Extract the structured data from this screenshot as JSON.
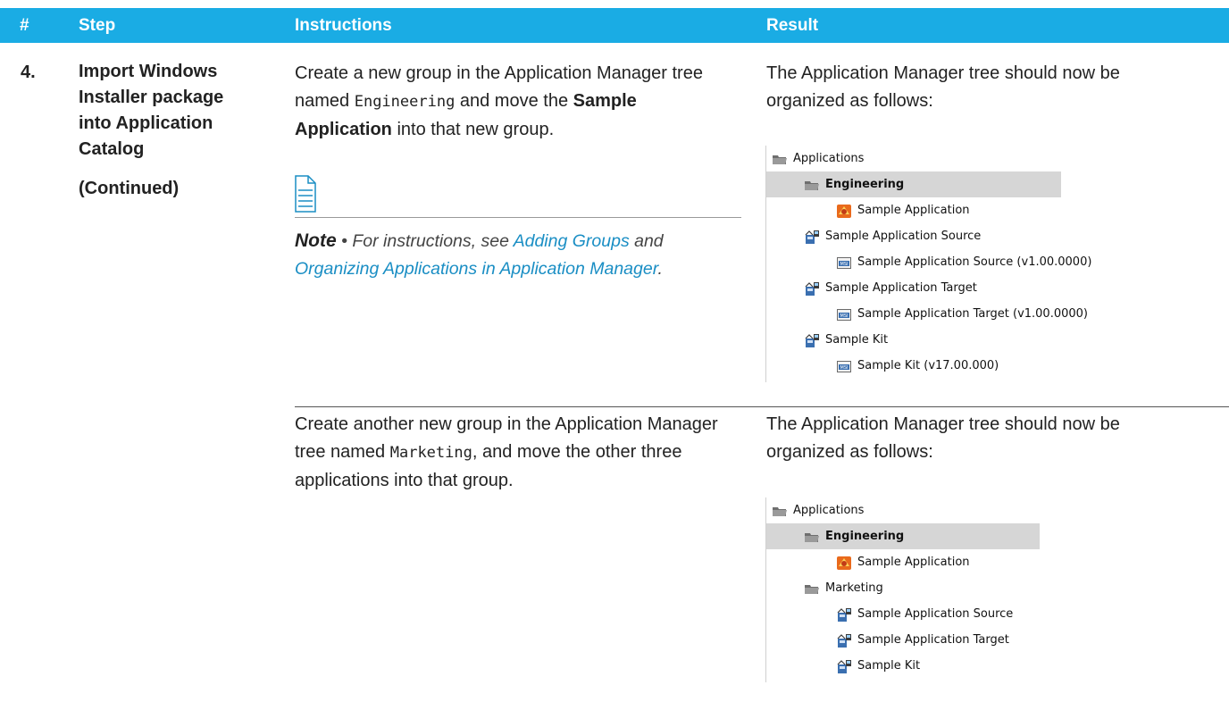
{
  "header": {
    "num": "#",
    "step": "Step",
    "instructions": "Instructions",
    "result": "Result"
  },
  "step": {
    "number": "4.",
    "title": "Import Windows Installer package into Application Catalog",
    "continued": "(Continued)"
  },
  "rows": [
    {
      "instructions": {
        "pre": "Create a new group in the Application Manager tree named ",
        "code": "Engineering",
        "mid": " and move the ",
        "bold": "Sample Application",
        "post": " into that new group."
      },
      "note": {
        "label": "Note",
        "bullet": " • ",
        "text_pre": "For instructions, see ",
        "link1": "Adding Groups",
        "text_mid": " and ",
        "link2": "Organizing Applications in Application Manager",
        "text_post": "."
      },
      "result": "The Application Manager tree should now be organized as follows:",
      "tree": [
        {
          "label": "Applications",
          "icon": "folder-icon",
          "selected": false,
          "bold": false
        },
        {
          "label": "Engineering",
          "icon": "folder-icon",
          "selected": true,
          "bold": true
        },
        {
          "label": "Sample Application",
          "icon": "application-icon",
          "selected": false,
          "bold": false
        },
        {
          "label": "Sample Application Source",
          "icon": "package-icon",
          "selected": false,
          "bold": false
        },
        {
          "label": "Sample Application Source (v1.00.0000)",
          "icon": "msi-icon",
          "selected": false,
          "bold": false
        },
        {
          "label": "Sample Application Target",
          "icon": "package-icon",
          "selected": false,
          "bold": false
        },
        {
          "label": "Sample Application Target (v1.00.0000)",
          "icon": "msi-icon",
          "selected": false,
          "bold": false
        },
        {
          "label": "Sample Kit",
          "icon": "package-icon",
          "selected": false,
          "bold": false
        },
        {
          "label": "Sample Kit (v17.00.000)",
          "icon": "msi-icon",
          "selected": false,
          "bold": false
        }
      ]
    },
    {
      "instructions": {
        "pre": "Create another new group in the Application Manager tree named ",
        "code": "Marketing",
        "mid": ", and move the other three applications into that group.",
        "bold": "",
        "post": ""
      },
      "result": "The Application Manager tree should now be organized as follows:",
      "tree": [
        {
          "label": "Applications",
          "icon": "folder-icon",
          "selected": false,
          "bold": false
        },
        {
          "label": "Engineering",
          "icon": "folder-icon",
          "selected": true,
          "bold": true
        },
        {
          "label": "Sample Application",
          "icon": "application-icon",
          "selected": false,
          "bold": false
        },
        {
          "label": "Marketing",
          "icon": "folder-icon",
          "selected": false,
          "bold": false
        },
        {
          "label": "Sample Application Source",
          "icon": "package-icon",
          "selected": false,
          "bold": false
        },
        {
          "label": "Sample Application Target",
          "icon": "package-icon",
          "selected": false,
          "bold": false
        },
        {
          "label": "Sample Kit",
          "icon": "package-icon",
          "selected": false,
          "bold": false
        }
      ]
    }
  ],
  "colors": {
    "header_bg": "#1aace4",
    "link": "#1a8ec4",
    "selection": "#d6d6d6"
  }
}
